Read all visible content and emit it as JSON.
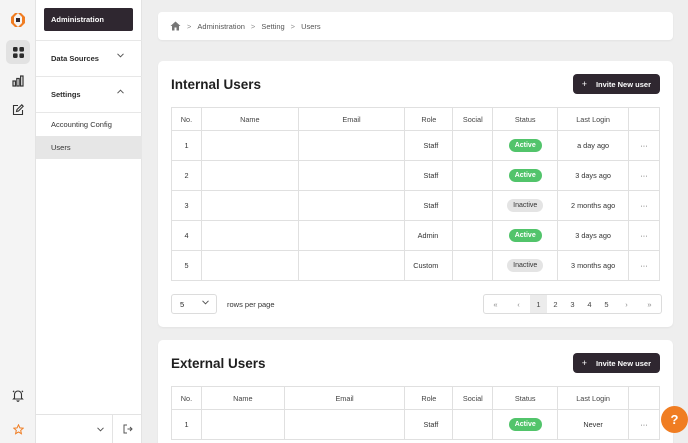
{
  "colors": {
    "brand_orange": "#f07d22",
    "dark": "#2f2730",
    "active_green": "#52c46b"
  },
  "sidebar": {
    "brand_label": "Administration",
    "sections": [
      {
        "label": "Data Sources",
        "expanded": false
      },
      {
        "label": "Settings",
        "expanded": true
      }
    ],
    "items": [
      {
        "label": "Accounting Config",
        "selected": false
      },
      {
        "label": "Users",
        "selected": true
      }
    ]
  },
  "breadcrumb": {
    "items": [
      "Administration",
      "Setting",
      "Users"
    ]
  },
  "internal_users": {
    "title": "Internal Users",
    "invite_label": "Invite New user",
    "columns": [
      "No.",
      "Name",
      "Email",
      "Role",
      "Social",
      "Status",
      "Last Login",
      ""
    ],
    "rows": [
      {
        "no": "1",
        "name": "",
        "email": "",
        "role": "Staff",
        "social": "",
        "status": "Active",
        "last_login": "a day ago",
        "actions": "···"
      },
      {
        "no": "2",
        "name": "",
        "email": "",
        "role": "Staff",
        "social": "",
        "status": "Active",
        "last_login": "3 days ago",
        "actions": "···"
      },
      {
        "no": "3",
        "name": "",
        "email": "",
        "role": "Staff",
        "social": "",
        "status": "Inactive",
        "last_login": "2 months ago",
        "actions": "···"
      },
      {
        "no": "4",
        "name": "",
        "email": "",
        "role": "Admin",
        "social": "",
        "status": "Active",
        "last_login": "3 days ago",
        "actions": "···"
      },
      {
        "no": "5",
        "name": "",
        "email": "",
        "role": "Custom",
        "social": "",
        "status": "Inactive",
        "last_login": "3 months ago",
        "actions": "···"
      }
    ],
    "pagination": {
      "rows_per_page_value": "5",
      "rows_per_page_label": "rows per page",
      "first": "«",
      "prev": "‹",
      "next": "›",
      "last": "»",
      "pages": [
        "1",
        "2",
        "3",
        "4",
        "5"
      ],
      "current": "1"
    }
  },
  "external_users": {
    "title": "External Users",
    "invite_label": "Invite New user",
    "columns": [
      "No.",
      "Name",
      "Email",
      "Role",
      "Social",
      "Status",
      "Last Login",
      ""
    ],
    "rows": [
      {
        "no": "1",
        "name": "",
        "email": "",
        "role": "Staff",
        "social": "",
        "status": "Active",
        "last_login": "Never",
        "actions": "···"
      }
    ]
  },
  "help_button": {
    "label": "?"
  }
}
